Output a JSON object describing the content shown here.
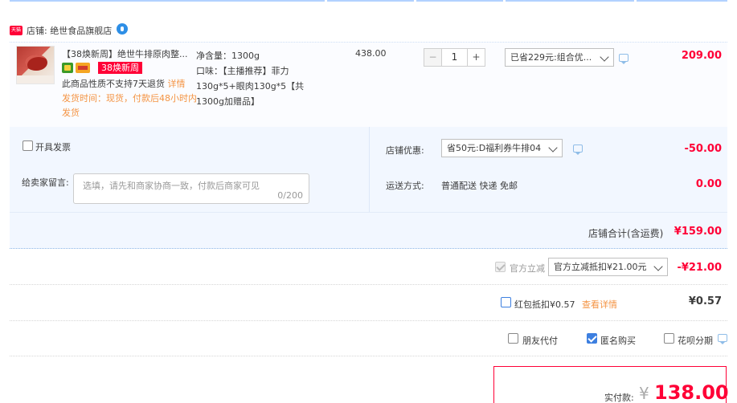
{
  "shop": {
    "label": "店铺: 绝世食品旗舰店",
    "badge": "天猫"
  },
  "item": {
    "title": "【38焕新周】绝世牛排原肉整...",
    "promo_badge": "38焕新周",
    "notice_plain": "此商品性质不支持7天退货 ",
    "notice_link": "详情",
    "ship_time": "发货时间：现货，付款后48小时内发货",
    "sku_lines": [
      "净含量：1300g",
      "口味：【主播推荐】菲力130g*5+眼肉130g*5【共1300g加赠品】"
    ],
    "unit_price": "438.00",
    "quantity": "1",
    "qty_minus": "−",
    "qty_plus": "+",
    "discount_select": "已省229元:组合优...",
    "total": "209.00"
  },
  "invoice": {
    "label": "开具发票"
  },
  "message": {
    "label": "给卖家留言:",
    "placeholder": "选填，请先和商家协商一致，付款后商家可见",
    "count": "0/200"
  },
  "shop_coupon": {
    "label": "店铺优惠:",
    "select": "省50元:D福利券牛排04",
    "amount": "-50.00"
  },
  "shipping": {
    "label": "运送方式:",
    "value": "普通配送 快递 免邮",
    "amount": "0.00"
  },
  "subtotal": {
    "label": "店铺合计(含运费)",
    "amount": "¥159.00"
  },
  "official_discount": {
    "label": "官方立减",
    "select": "官方立减抵扣¥21.00元",
    "amount": "-¥21.00"
  },
  "red_packet": {
    "label": "红包抵扣¥0.57",
    "link": "查看详情",
    "amount": "¥0.57"
  },
  "options": {
    "friend_pay": "朋友代付",
    "anonymous": "匿名购买",
    "huabei": "花呗分期"
  },
  "payment": {
    "label": "实付款:",
    "currency": "¥",
    "amount": "138.00"
  },
  "colors": {
    "accent_red": "#ff0036",
    "link_orange": "#f49444",
    "light_blue_bg": "#f2f7ff"
  }
}
